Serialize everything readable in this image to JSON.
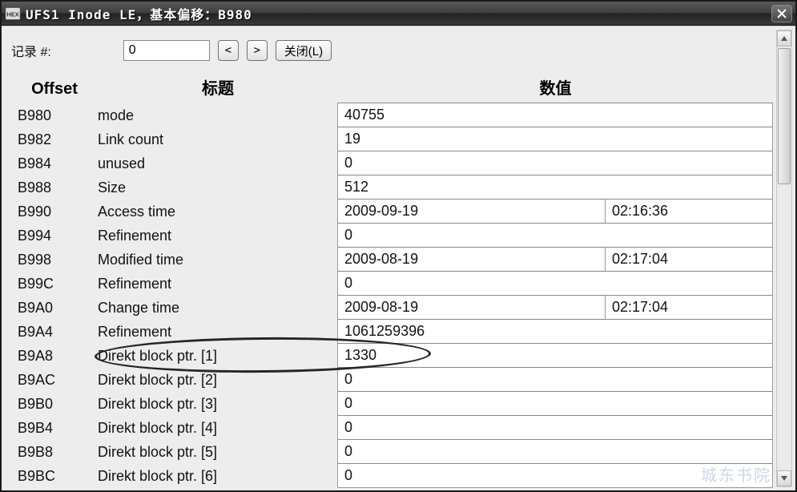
{
  "window": {
    "title": "UFS1 Inode LE，基本偏移：B980"
  },
  "toolbar": {
    "record_label": "记录 #:",
    "record_value": "0",
    "prev": "<",
    "next": ">",
    "close": "关闭(L)"
  },
  "headers": {
    "offset": "Offset",
    "label": "标题",
    "value": "数值"
  },
  "rows": [
    {
      "offset": "B980",
      "label": "mode",
      "values": [
        "40755"
      ]
    },
    {
      "offset": "B982",
      "label": "Link count",
      "values": [
        "19"
      ]
    },
    {
      "offset": "B984",
      "label": "unused",
      "values": [
        "0"
      ]
    },
    {
      "offset": "B988",
      "label": "Size",
      "values": [
        "512"
      ]
    },
    {
      "offset": "B990",
      "label": "Access time",
      "values": [
        "2009-09-19",
        "02:16:36"
      ]
    },
    {
      "offset": "B994",
      "label": "Refinement",
      "values": [
        "0"
      ]
    },
    {
      "offset": "B998",
      "label": "Modified time",
      "values": [
        "2009-08-19",
        "02:17:04"
      ]
    },
    {
      "offset": "B99C",
      "label": "Refinement",
      "values": [
        "0"
      ]
    },
    {
      "offset": "B9A0",
      "label": "Change time",
      "values": [
        "2009-08-19",
        "02:17:04"
      ]
    },
    {
      "offset": "B9A4",
      "label": "Refinement",
      "values": [
        "1061259396"
      ]
    },
    {
      "offset": "B9A8",
      "label": "Direkt block ptr. [1]",
      "values": [
        "1330"
      ],
      "highlight": true
    },
    {
      "offset": "B9AC",
      "label": "Direkt block ptr. [2]",
      "values": [
        "0"
      ]
    },
    {
      "offset": "B9B0",
      "label": "Direkt block ptr. [3]",
      "values": [
        "0"
      ]
    },
    {
      "offset": "B9B4",
      "label": "Direkt block ptr. [4]",
      "values": [
        "0"
      ]
    },
    {
      "offset": "B9B8",
      "label": "Direkt block ptr. [5]",
      "values": [
        "0"
      ]
    },
    {
      "offset": "B9BC",
      "label": "Direkt block ptr. [6]",
      "values": [
        "0"
      ]
    }
  ],
  "watermark": {
    "main": "城东书院",
    "sub": ""
  }
}
